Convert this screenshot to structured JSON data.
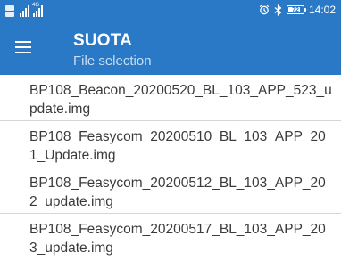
{
  "status_bar": {
    "time": "14:02",
    "battery_level": "72",
    "icons": [
      "sim-icon",
      "signal-icon",
      "signal-4g-icon",
      "alarm-icon",
      "bluetooth-icon",
      "battery-icon"
    ]
  },
  "toolbar": {
    "title": "SUOTA",
    "subtitle": "File selection",
    "menu_icon": "hamburger-menu-icon"
  },
  "files": [
    {
      "name": "BP108_Beacon_20200520_BL_103_APP_523_update.img"
    },
    {
      "name": "BP108_Feasycom_20200510_BL_103_APP_201_Update.img"
    },
    {
      "name": "BP108_Feasycom_20200512_BL_103_APP_202_update.img"
    },
    {
      "name": "BP108_Feasycom_20200517_BL_103_APP_203_update.img"
    }
  ],
  "colors": {
    "primary": "#2a79c7",
    "text": "#3a3a3a",
    "divider": "#d6d6d6"
  }
}
